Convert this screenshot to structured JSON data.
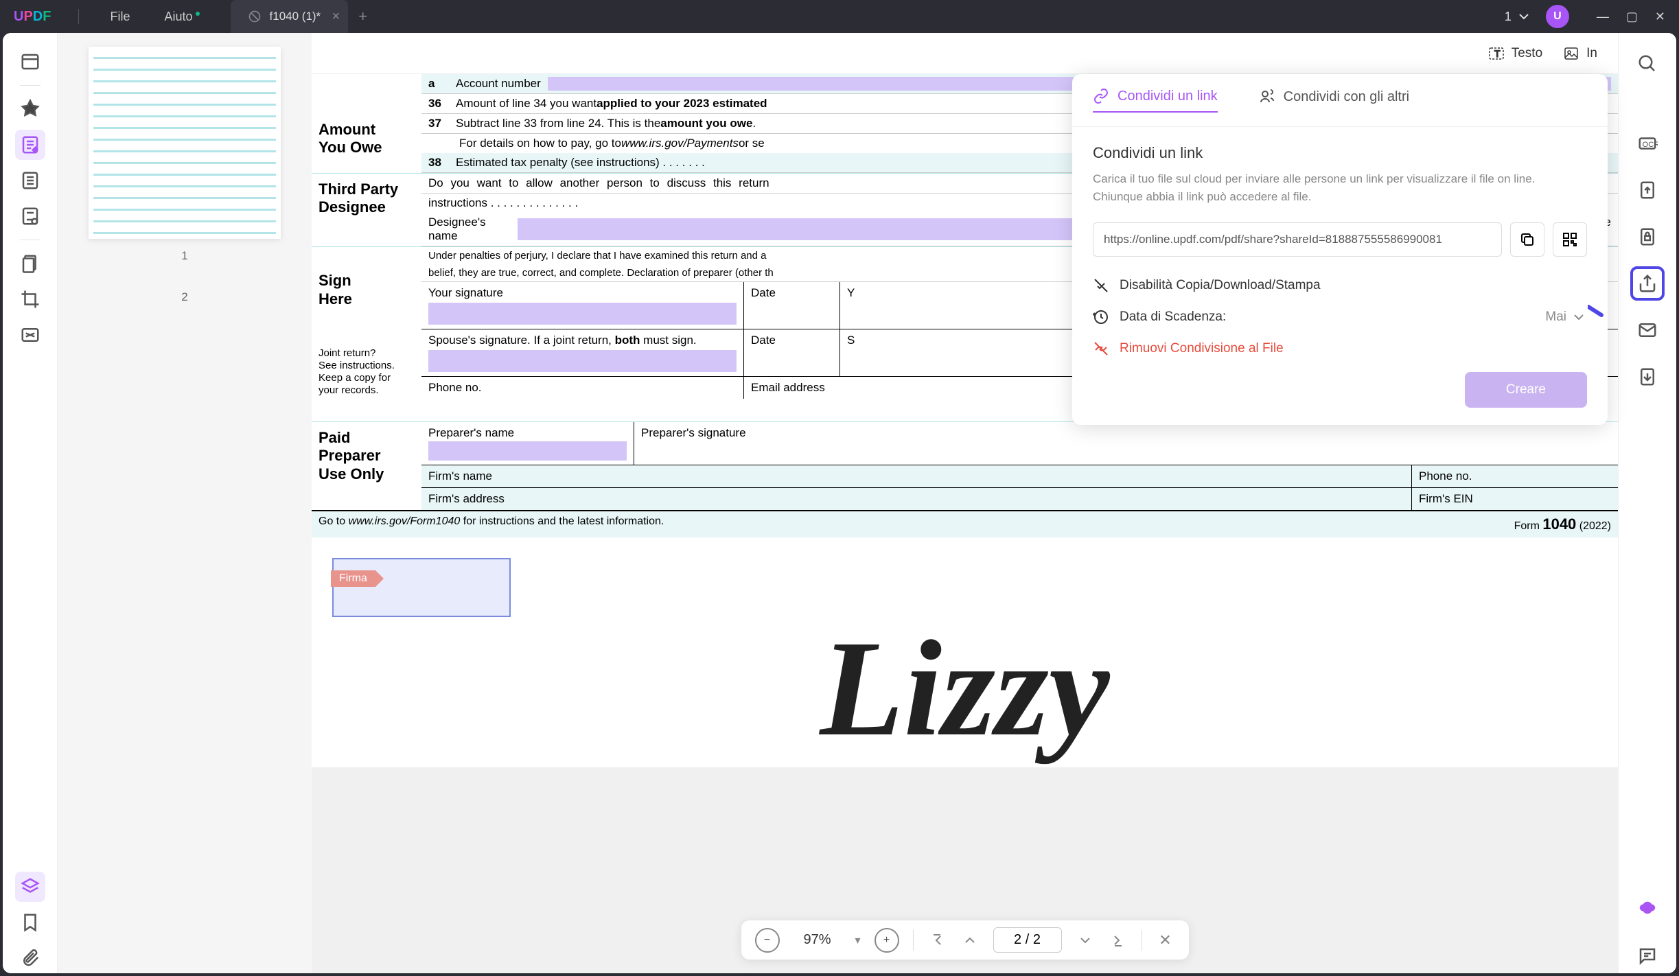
{
  "menu": {
    "file": "File",
    "help": "Aiuto"
  },
  "tab": {
    "title": "f1040 (1)*"
  },
  "titlebar": {
    "count": "1",
    "avatar": "U"
  },
  "thumbnails": {
    "page1": "1",
    "page2": "2",
    "sig_preview": "Lizzy"
  },
  "tools": {
    "text": "Testo",
    "image_prefix": "In"
  },
  "form": {
    "amount_owe": "Amount\nYou Owe",
    "third_party": "Third Party\nDesignee",
    "sign_here": "Sign\nHere",
    "paid_preparer": "Paid\nPreparer\nUse Only",
    "line_a": "a",
    "line_a_text": "Account number",
    "line36": "36",
    "line36_text": "Amount of line 34 you want ",
    "line36_bold": "applied to your 2023 estimated",
    "line37": "37",
    "line37_text": "Subtract line 33 from line 24. This is the ",
    "line37_bold": "amount you owe",
    "line37_detail": "For details on how to pay, go to ",
    "line37_url": "www.irs.gov/Payments",
    "line37_suffix": " or se",
    "line38": "38",
    "line38_text": "Estimated tax penalty (see instructions)  .   .   .   .   .   .   .",
    "tp_q": "Do you want to allow another person to discuss this return",
    "tp_inst": "instructions     .     .     .     .     .     .     .     .     .     .     .     .     .     .",
    "designee": "Designee's\nname",
    "phone": "Phone\nno.",
    "perjury": "Under penalties of perjury, I declare that I have examined this return and a",
    "perjury2": "belief, they are true, correct, and complete. Declaration of preparer (other th",
    "your_sig": "Your signature",
    "date": "Date",
    "y": "Y",
    "joint": "Joint return?\nSee instructions.\nKeep a copy for\nyour records.",
    "spouse_sig": "Spouse's signature. If a joint return, ",
    "both": "both",
    "must_sign": " must sign.",
    "s": "S",
    "phone_no": "Phone no.",
    "email": "Email address",
    "prep_name": "Preparer's name",
    "prep_sig": "Preparer's signature",
    "firm_name": "Firm's name",
    "firm_phone": "Phone no.",
    "firm_addr": "Firm's address",
    "firm_ein": "Firm's EIN",
    "goto": "Go to ",
    "goto_url": "www.irs.gov/Form1040",
    "goto_suffix": " for instructions and the latest information.",
    "form_no": "Form",
    "form_1040": "1040",
    "form_year": "(2022)",
    "firma_tag": "Firma"
  },
  "signature": "Lizzy",
  "share": {
    "tab_link": "Condividi un link",
    "tab_others": "Condividi con gli altri",
    "title": "Condividi un link",
    "desc": "Carica il tuo file sul cloud per inviare alle persone un link per visualizzare il file on line. Chiunque abbia il link può accedere al file.",
    "url": "https://online.updf.com/pdf/share?shareId=818887555586990081",
    "disable": "Disabilità Copia/Download/Stampa",
    "expiry": "Data di Scadenza:",
    "expiry_val": "Mai",
    "remove": "Rimuovi Condivisione al File",
    "create": "Creare"
  },
  "bottom": {
    "zoom": "97%",
    "page": "2 / 2"
  }
}
